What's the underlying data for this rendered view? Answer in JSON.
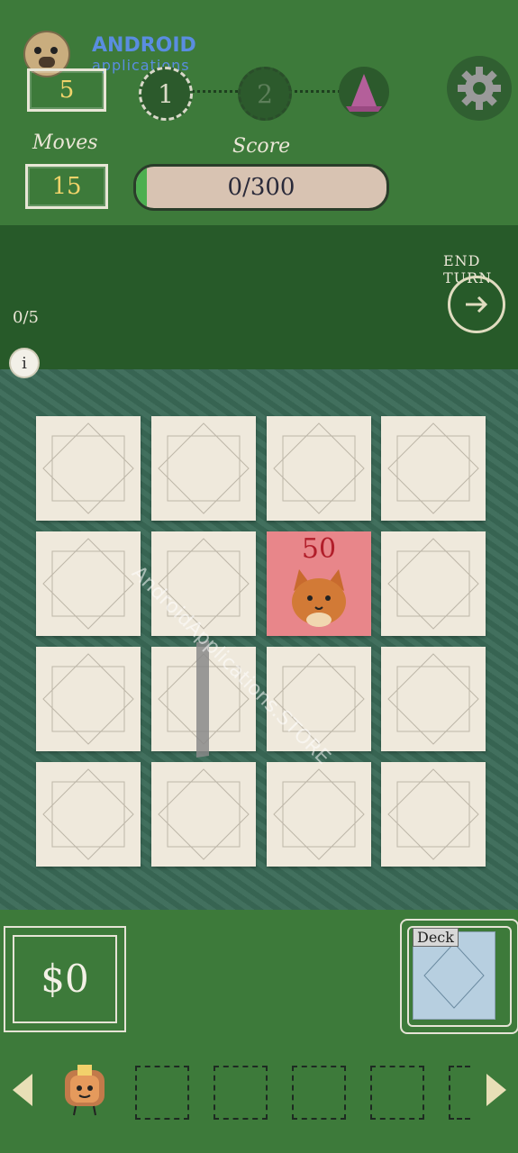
{
  "header": {
    "turns_value": "5",
    "moves_label": "Moves",
    "moves_value": "15",
    "score_label": "Score",
    "score_value": "0/300",
    "score_progress": 0.0,
    "levels": [
      "1",
      "2"
    ],
    "settings_icon": "gear-icon",
    "boss_icon": "wizard-hat-icon"
  },
  "watermark": {
    "brand_top": "ANDROID",
    "brand_bottom": "applications",
    "diagonal": "AndroidApplications.STORE"
  },
  "turn": {
    "end_turn_label": "END TURN",
    "counter": "0/5",
    "info_label": "i"
  },
  "board": {
    "rows": 4,
    "cols": 4,
    "cat_card": {
      "value": "50",
      "row": 1,
      "col": 2
    }
  },
  "footer": {
    "money": "$0",
    "deck_label": "Deck",
    "colors": {
      "green": "#3d7a3a",
      "dark_green": "#275a29",
      "card": "#efe9dc",
      "cat_card": "#e8868a"
    }
  }
}
